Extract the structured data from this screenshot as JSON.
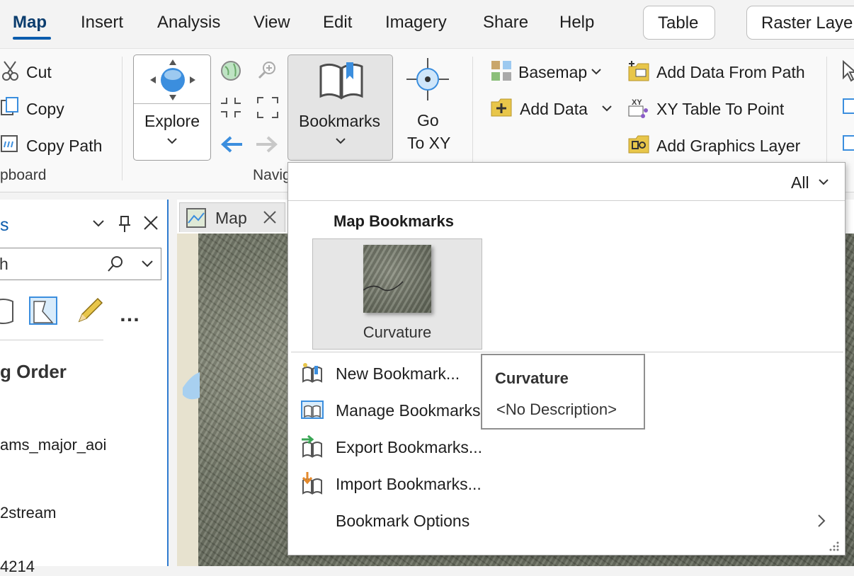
{
  "tabs": {
    "map": "Map",
    "insert": "Insert",
    "analysis": "Analysis",
    "view": "View",
    "edit": "Edit",
    "imagery": "Imagery",
    "share": "Share",
    "help": "Help",
    "table": "Table",
    "raster_layer": "Raster Laye"
  },
  "clipboard": {
    "cut": "Cut",
    "copy": "Copy",
    "copy_path": "Copy Path",
    "group_label": "pboard"
  },
  "navigate": {
    "explore": "Explore",
    "bookmarks": "Bookmarks",
    "go_to_xy_line1": "Go",
    "go_to_xy_line2": "To XY",
    "group_label": "Navig"
  },
  "layer": {
    "basemap": "Basemap",
    "add_data": "Add Data",
    "add_data_from_path": "Add Data From Path",
    "xy_table_to_point": "XY Table To Point",
    "add_graphics_layer": "Add Graphics Layer"
  },
  "left_pane": {
    "title_fragment": "s",
    "search_fragment": "h",
    "heading": "g Order",
    "items": [
      "ams_major_aoi",
      "2stream",
      "4214"
    ]
  },
  "map_tab": {
    "label": "Map"
  },
  "bookmarks_menu": {
    "filter": "All",
    "section_title": "Map Bookmarks",
    "bookmark_name": "Curvature",
    "items": [
      "New Bookmark...",
      "Manage Bookmarks",
      "Export Bookmarks...",
      "Import Bookmarks...",
      "Bookmark Options"
    ]
  },
  "tooltip": {
    "title": "Curvature",
    "description": "<No Description>"
  },
  "colors": {
    "accent": "#0b5cad",
    "pane_border": "#2e7bcf",
    "icon_blue": "#3b8ede",
    "icon_gold": "#e8c64a"
  }
}
